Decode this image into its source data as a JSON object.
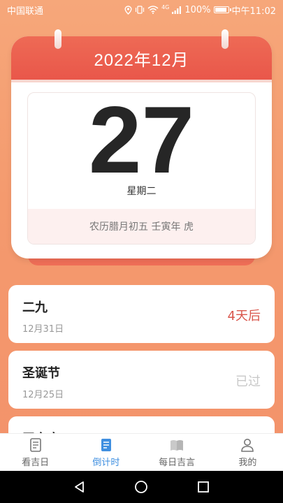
{
  "status_bar": {
    "carrier": "中国联通",
    "battery": "100%",
    "time": "中午11:02",
    "signal_label": "4G"
  },
  "calendar": {
    "month_title": "2022年12月",
    "day": "27",
    "weekday": "星期二",
    "lunar": "农历腊月初五 壬寅年 虎",
    "header_color": "#e9574a"
  },
  "countdowns": [
    {
      "title": "二九",
      "date": "12月31日",
      "status": "4天后",
      "state": "future"
    },
    {
      "title": "圣诞节",
      "date": "12月25日",
      "status": "已过",
      "state": "past"
    },
    {
      "title": "平安夜",
      "date": "",
      "status": "",
      "state": "past"
    }
  ],
  "bottom_nav": [
    {
      "label": "看吉日",
      "icon": "document-icon",
      "active": false
    },
    {
      "label": "倒计时",
      "icon": "list-document-icon",
      "active": true
    },
    {
      "label": "每日吉言",
      "icon": "book-icon",
      "active": false
    },
    {
      "label": "我的",
      "icon": "person-icon",
      "active": false
    }
  ],
  "colors": {
    "accent_blue": "#3f8fe0",
    "future_red": "#d9554b",
    "background": "#f49a6e"
  }
}
